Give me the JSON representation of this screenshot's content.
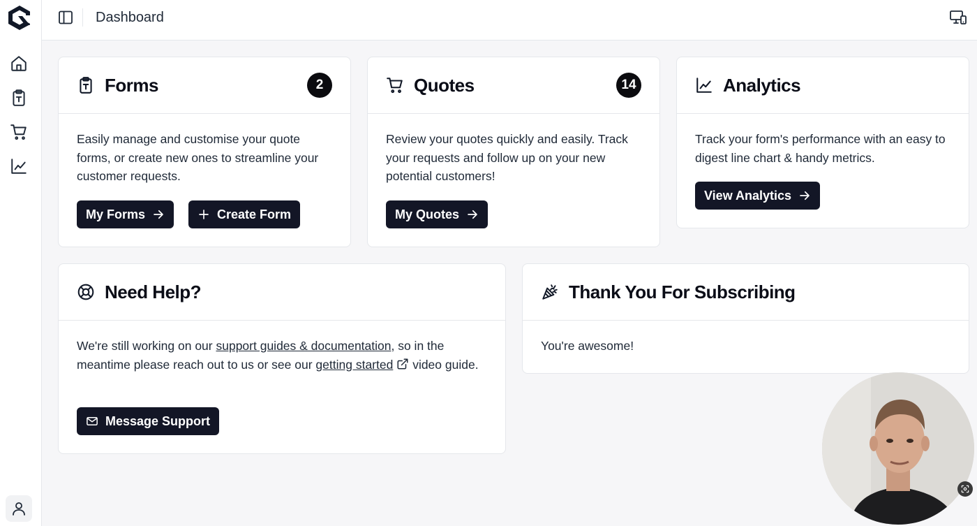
{
  "app": {
    "page_title": "Dashboard"
  },
  "sidebar": {
    "items": [
      {
        "name": "home",
        "icon": "home-icon"
      },
      {
        "name": "forms",
        "icon": "clipboard-icon"
      },
      {
        "name": "quotes",
        "icon": "cart-icon"
      },
      {
        "name": "analytics",
        "icon": "line-chart-icon"
      }
    ],
    "user_icon": "user-icon"
  },
  "cards": {
    "forms": {
      "title": "Forms",
      "count": "2",
      "description": "Easily manage and customise your quote forms, or create new ones to streamline your customer requests.",
      "primary_button": "My Forms",
      "secondary_button": "Create Form"
    },
    "quotes": {
      "title": "Quotes",
      "count": "14",
      "description": "Review your quotes quickly and easily. Track your requests and follow up on your new potential customers!",
      "primary_button": "My Quotes"
    },
    "analytics": {
      "title": "Analytics",
      "description": "Track your form's performance with an easy to digest line chart & handy metrics.",
      "primary_button": "View Analytics"
    },
    "help": {
      "title": "Need Help?",
      "text_before": "We're still working on our ",
      "link_docs": "support guides & documentation",
      "text_middle": ", so in the meantime please reach out to us or see our ",
      "link_started": "getting started",
      "text_after": " video guide.",
      "button": "Message Support"
    },
    "thanks": {
      "title": "Thank You For Subscribing",
      "message": "You're awesome!"
    }
  },
  "colors": {
    "button_bg": "#131626",
    "badge_bg": "#0b0b0f",
    "page_bg": "#f6f6f8",
    "card_border": "#e5e7eb"
  }
}
